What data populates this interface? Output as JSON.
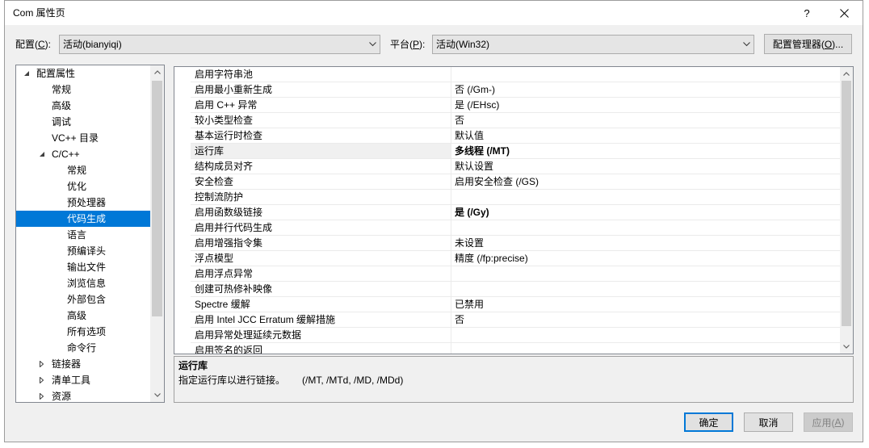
{
  "window": {
    "title": "Com 属性页",
    "help_label": "?"
  },
  "toolbar": {
    "configuration_label": "配置(C):",
    "configuration_value": "活动(bianyiqi)",
    "platform_label": "平台(P):",
    "platform_value": "活动(Win32)",
    "configuration_manager_label": "配置管理器(O)..."
  },
  "tree": {
    "items": [
      {
        "label": "配置属性",
        "level": 0,
        "expanded": true
      },
      {
        "label": "常规",
        "level": 1
      },
      {
        "label": "高级",
        "level": 1
      },
      {
        "label": "调试",
        "level": 1
      },
      {
        "label": "VC++ 目录",
        "level": 1
      },
      {
        "label": "C/C++",
        "level": 1,
        "expanded": true
      },
      {
        "label": "常规",
        "level": 2
      },
      {
        "label": "优化",
        "level": 2
      },
      {
        "label": "预处理器",
        "level": 2
      },
      {
        "label": "代码生成",
        "level": 2,
        "selected": true
      },
      {
        "label": "语言",
        "level": 2
      },
      {
        "label": "预编译头",
        "level": 2
      },
      {
        "label": "输出文件",
        "level": 2
      },
      {
        "label": "浏览信息",
        "level": 2
      },
      {
        "label": "外部包含",
        "level": 2
      },
      {
        "label": "高级",
        "level": 2
      },
      {
        "label": "所有选项",
        "level": 2
      },
      {
        "label": "命令行",
        "level": 2
      },
      {
        "label": "链接器",
        "level": 1,
        "expanded": false
      },
      {
        "label": "清单工具",
        "level": 1,
        "expanded": false
      },
      {
        "label": "资源",
        "level": 1,
        "expanded": false
      }
    ]
  },
  "properties": {
    "rows": [
      {
        "name": "启用字符串池"
      },
      {
        "name": "启用最小重新生成",
        "value": "否 (/Gm-)"
      },
      {
        "name": "启用 C++ 异常",
        "value": "是 (/EHsc)"
      },
      {
        "name": "较小类型检查",
        "value": "否"
      },
      {
        "name": "基本运行时检查",
        "value": "默认值"
      },
      {
        "name": "运行库",
        "value": "多线程 (/MT)",
        "bold": true,
        "selected": true
      },
      {
        "name": "结构成员对齐",
        "value": "默认设置"
      },
      {
        "name": "安全检查",
        "value": "启用安全检查 (/GS)"
      },
      {
        "name": "控制流防护"
      },
      {
        "name": "启用函数级链接",
        "value": "是 (/Gy)",
        "bold": true
      },
      {
        "name": "启用并行代码生成"
      },
      {
        "name": "启用增强指令集",
        "value": "未设置"
      },
      {
        "name": "浮点模型",
        "value": "精度 (/fp:precise)"
      },
      {
        "name": "启用浮点异常"
      },
      {
        "name": "创建可热修补映像"
      },
      {
        "name": "Spectre 缓解",
        "value": "已禁用"
      },
      {
        "name": "启用 Intel JCC Erratum 缓解措施",
        "value": "否"
      },
      {
        "name": "启用异常处理延续元数据"
      },
      {
        "name": "启用签名的返回"
      }
    ]
  },
  "description": {
    "title": "运行库",
    "text": "指定运行库以进行链接。",
    "switches": "(/MT, /MTd, /MD, /MDd)"
  },
  "buttons": {
    "ok": "确定",
    "cancel": "取消",
    "apply": "应用(A)",
    "apply_enabled": false
  },
  "colors": {
    "selection": "#0078d7",
    "default_button_border": "#0078d7"
  }
}
